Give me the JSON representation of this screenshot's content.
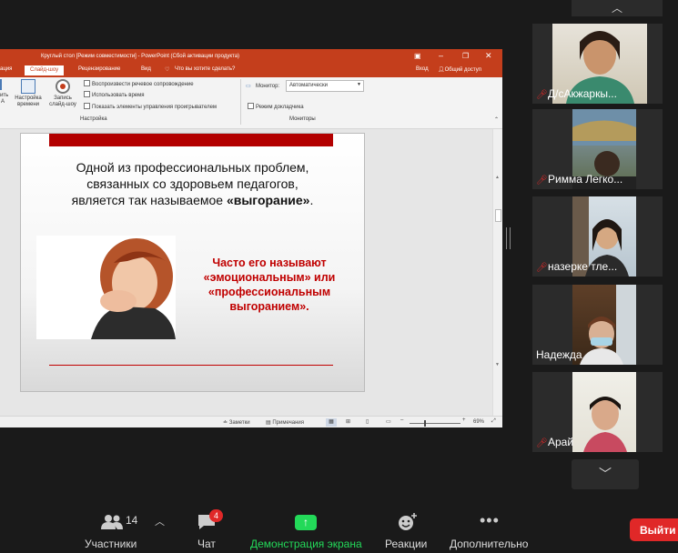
{
  "ppt": {
    "title": "Круглый стол [Режим совместимости] - PowerPoint (Сбой активации продукта)",
    "tabs": [
      "ация",
      "Слайд-шоу",
      "Рецензирование",
      "Вид"
    ],
    "tell_me": "Что вы хотите сделать?",
    "login": "Вход",
    "share": "Общий доступ",
    "ribbon": {
      "btn_a": "ить\nА",
      "btn_setup": "Настройка\nвремени",
      "btn_record": "Запись\nслайд-шоу",
      "cb1": "Воспроизвести речевое сопровождение",
      "cb2": "Использовать время",
      "cb3": "Показать элементы управления проигрывателем",
      "group1": "Настройка",
      "monitor_label": "Монитор:",
      "monitor_value": "Автоматически",
      "presenter": "Режим докладчика",
      "group2": "Мониторы"
    },
    "slide": {
      "text1_a": "Одной из профессиональных проблем,",
      "text1_b": "связанных со здоровьем педагогов,",
      "text1_c": "является так называемое ",
      "text1_bold": "«выгорание»",
      "text1_end": ".",
      "red_1": "Часто его называют",
      "red_2": "«эмоциональным» или",
      "red_3": "«профессиональным",
      "red_4": "выгоранием»."
    },
    "status": {
      "notes": "Заметки",
      "comments": "Примечания",
      "zoom": "69%"
    }
  },
  "participants": [
    {
      "name": "Д/сАкжаркы...",
      "muted": true
    },
    {
      "name": "Римма Легко...",
      "muted": true
    },
    {
      "name": "назерке тле...",
      "muted": true
    },
    {
      "name": "Надежда",
      "muted": false
    },
    {
      "name": "Арай",
      "muted": true
    }
  ],
  "toolbar": {
    "participants_label": "Участники",
    "participants_count": "14",
    "chat_label": "Чат",
    "chat_badge": "4",
    "share_label": "Демонстрация экрана",
    "reactions_label": "Реакции",
    "more_label": "Дополнительно",
    "leave_label": "Выйти"
  },
  "colors": {
    "ppt_accent": "#c43e1c",
    "slide_red": "#c00000",
    "share_green": "#23d959",
    "leave_red": "#e02828"
  }
}
